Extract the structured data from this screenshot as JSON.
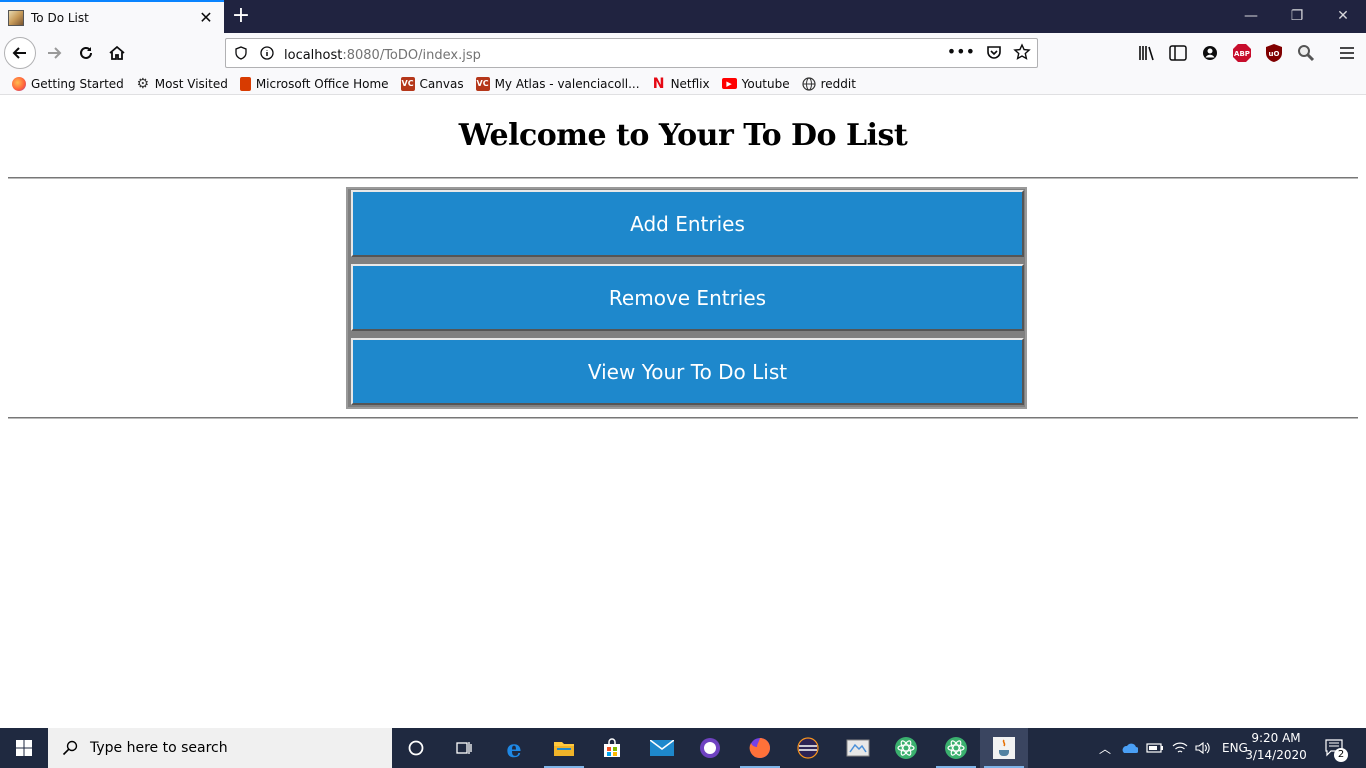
{
  "browser": {
    "tab_title": "To Do List",
    "url_host": "localhost",
    "url_path": ":8080/ToDO/index.jsp",
    "bookmarks": [
      {
        "label": "Getting Started",
        "icon": "firefox-icon"
      },
      {
        "label": "Most Visited",
        "icon": "gear-icon"
      },
      {
        "label": "Microsoft Office Home",
        "icon": "office-icon"
      },
      {
        "label": "Canvas",
        "icon": "vc-icon"
      },
      {
        "label": "My Atlas - valenciacoll...",
        "icon": "vc-icon"
      },
      {
        "label": "Netflix",
        "icon": "netflix-icon"
      },
      {
        "label": "Youtube",
        "icon": "youtube-icon"
      },
      {
        "label": "reddit",
        "icon": "globe-icon"
      }
    ],
    "extension_labels": {
      "abp": "ABP",
      "ublock": "uO"
    }
  },
  "page": {
    "title": "Welcome to Your To Do List",
    "buttons": [
      {
        "label": "Add Entries"
      },
      {
        "label": "Remove Entries"
      },
      {
        "label": "View Your To Do List"
      }
    ]
  },
  "taskbar": {
    "search_placeholder": "Type here to search",
    "language": "ENG",
    "time": "9:20 AM",
    "date": "3/14/2020",
    "notification_count": "2"
  },
  "colors": {
    "button_bg": "#1e88cc",
    "tab_accent": "#0a84ff",
    "titlebar_bg": "#202340",
    "taskbar_bg": "#1f2940"
  }
}
